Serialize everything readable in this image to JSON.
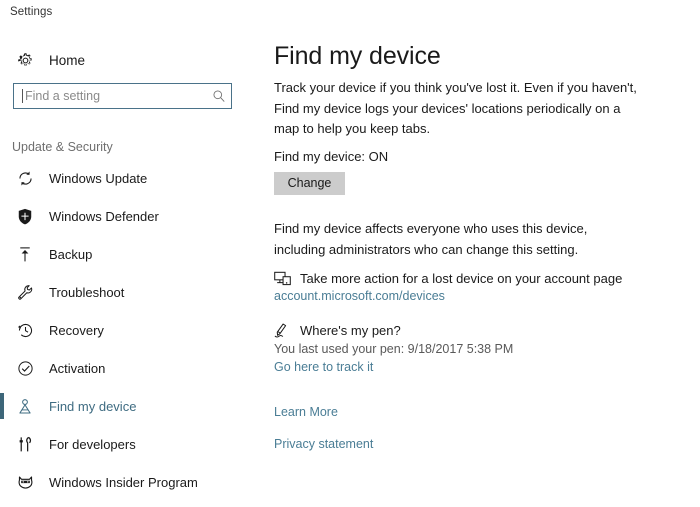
{
  "window": {
    "title": "Settings"
  },
  "sidebar": {
    "home": {
      "label": "Home",
      "icon": "gear-icon"
    },
    "search": {
      "placeholder": "Find a setting",
      "value": "",
      "icon": "search-icon"
    },
    "group_header": "Update & Security",
    "items": [
      {
        "label": "Windows Update",
        "icon": "sync-icon",
        "selected": false
      },
      {
        "label": "Windows Defender",
        "icon": "shield-icon",
        "selected": false
      },
      {
        "label": "Backup",
        "icon": "upload-icon",
        "selected": false
      },
      {
        "label": "Troubleshoot",
        "icon": "wrench-icon",
        "selected": false
      },
      {
        "label": "Recovery",
        "icon": "history-clock-icon",
        "selected": false
      },
      {
        "label": "Activation",
        "icon": "check-circle-icon",
        "selected": false
      },
      {
        "label": "Find my device",
        "icon": "person-location-icon",
        "selected": true
      },
      {
        "label": "For developers",
        "icon": "tools-icon",
        "selected": false
      },
      {
        "label": "Windows Insider Program",
        "icon": "ninja-cat-icon",
        "selected": false
      }
    ]
  },
  "main": {
    "page_title": "Find my device",
    "intro": "Track your device if you think you've lost it. Even if you haven't, Find my device logs your devices' locations periodically on a map to help you keep tabs.",
    "status_line": "Find my device: ON",
    "change_button": "Change",
    "affects_text": "Find my device affects everyone who uses this device, including administrators who can change this setting.",
    "devices_block": {
      "icon": "devices-icon",
      "text": "Take more action for a lost device on your account page",
      "link": "account.microsoft.com/devices"
    },
    "pen_block": {
      "icon": "pen-icon",
      "heading": "Where's my pen?",
      "last_used": "You last used your pen: 9/18/2017 5:38 PM",
      "link": "Go here to track it"
    },
    "learn_more": "Learn More",
    "privacy_statement": "Privacy statement"
  },
  "colors": {
    "accent": "#3d6679",
    "link": "#4a7d95",
    "button_bg": "#cccccc",
    "search_border": "#4a7289",
    "muted_text": "#6f6f6f",
    "background": "#ffffff"
  }
}
